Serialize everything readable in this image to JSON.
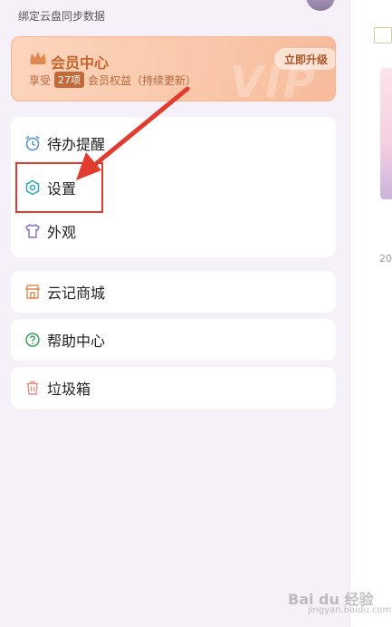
{
  "header": {
    "sync_text": "绑定云盘同步数据"
  },
  "vip": {
    "title": "会员中心",
    "sub_prefix": "享受",
    "count": "27项",
    "sub_suffix": "会员权益（持续更新）",
    "upgrade_label": "立即升级",
    "watermark": "VIP"
  },
  "menu": {
    "reminders": "待办提醒",
    "settings": "设置",
    "appearance": "外观",
    "store": "云记商城",
    "help": "帮助中心",
    "trash": "垃圾箱"
  },
  "right_panel": {
    "date_fragment": "20"
  },
  "watermark": {
    "brand": "Bai du 经验",
    "url": "jingyan.baidu.com"
  },
  "colors": {
    "accent": "#c4652c",
    "highlight": "#e23b2f",
    "reminder": "#4a8fd6",
    "settings": "#2aa7b8",
    "appearance": "#8b6bc2",
    "store": "#e0894f",
    "help": "#3aa55a",
    "trash": "#d9938a"
  }
}
